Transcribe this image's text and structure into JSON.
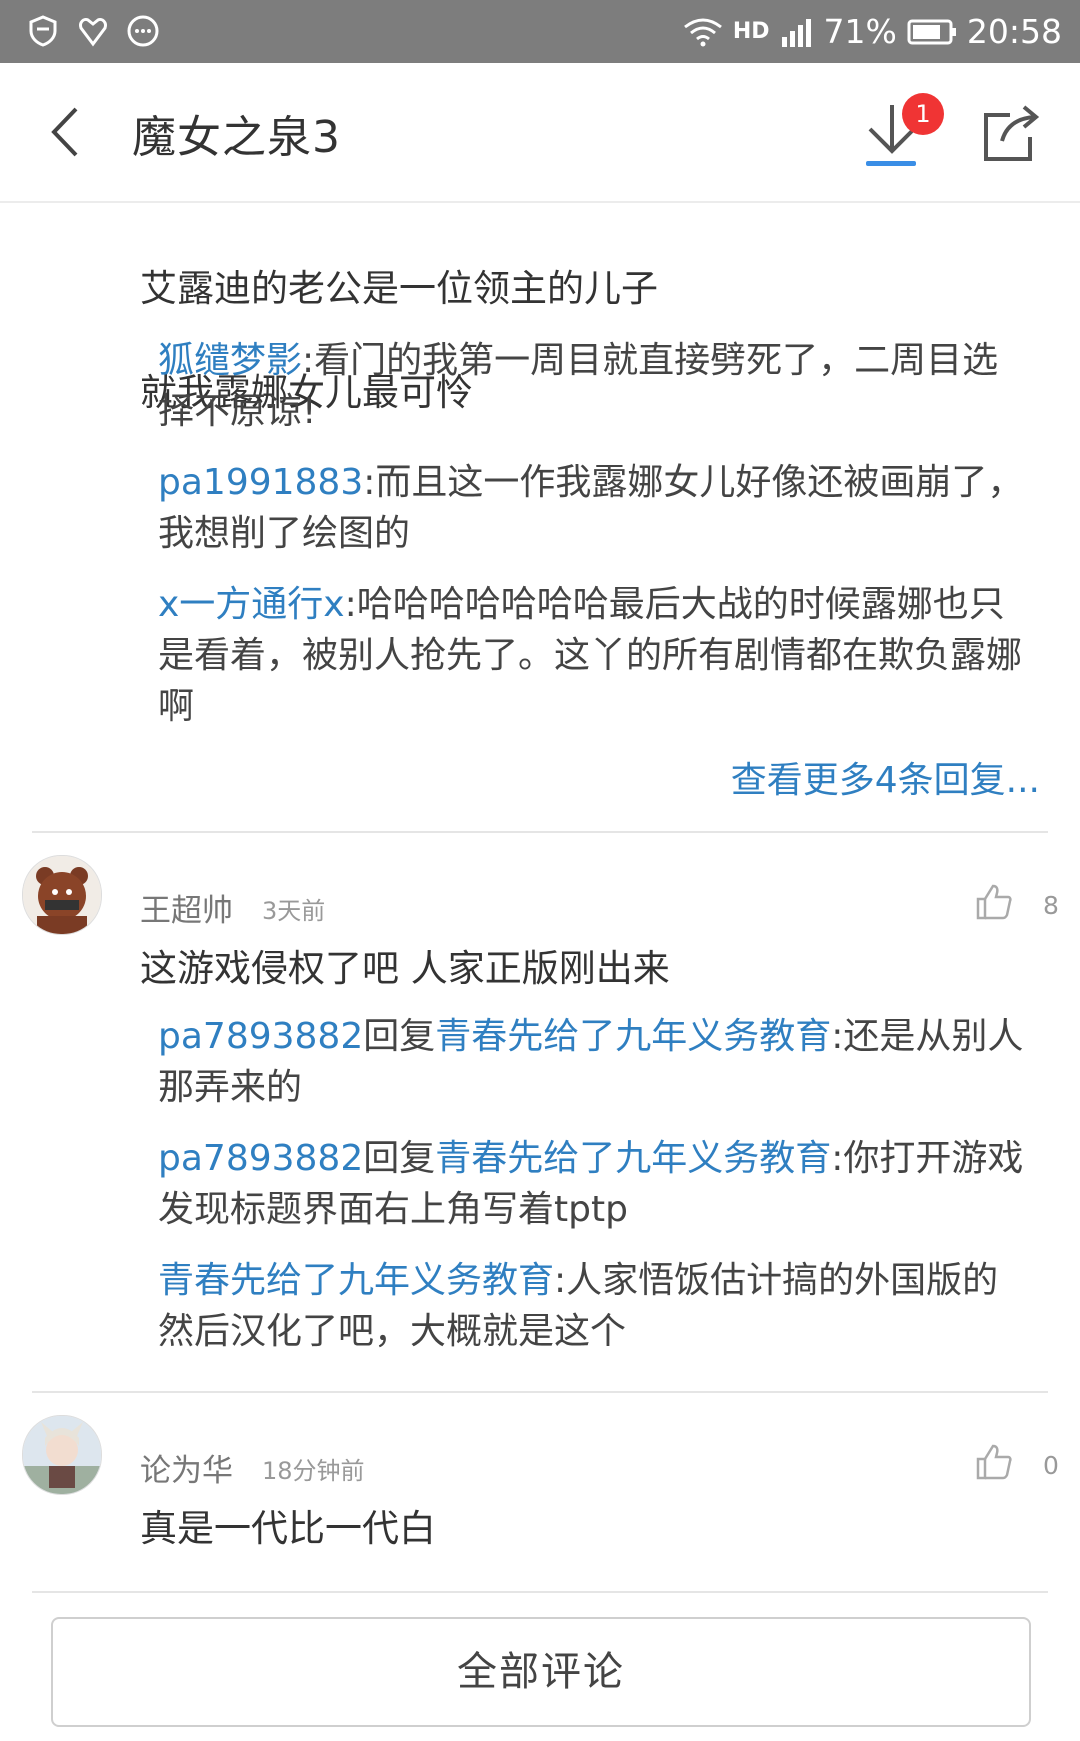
{
  "status_bar": {
    "battery": "71%",
    "time": "20:58",
    "network": "HD"
  },
  "header": {
    "title": "魔女之泉3",
    "download_badge": "1"
  },
  "comment1": {
    "text_lines": [
      "艾露迪的老公是一位领主的儿子",
      "就我露娜女儿最可怜"
    ],
    "replies": [
      {
        "user": "狐缱梦影",
        "text": ":看门的我第一周目就直接劈死了，二周目选择不原谅!"
      },
      {
        "user": "pa1991883",
        "text": ":而且这一作我露娜女儿好像还被画崩了，我想削了绘图的"
      },
      {
        "user": "x一方通行x",
        "text": ":哈哈哈哈哈哈哈最后大战的时候露娜也只是看着，被别人抢先了。这丫的所有剧情都在欺负露娜啊"
      }
    ],
    "more_replies": "查看更多4条回复..."
  },
  "comment2": {
    "author": "王超帅",
    "time": "3天前",
    "likes": "8",
    "text": "这游戏侵权了吧 人家正版刚出来",
    "replies": [
      {
        "user": "pa7893882",
        "reply_word": "回复",
        "target": "青春先给了九年义务教育",
        "text": ":还是从别人那弄来的"
      },
      {
        "user": "pa7893882",
        "reply_word": "回复",
        "target": "青春先给了九年义务教育",
        "text": ":你打开游戏发现标题界面右上角写着tptp"
      },
      {
        "user": "青春先给了九年义务教育",
        "text": ":人家悟饭估计搞的外国版的然后汉化了吧，大概就是这个"
      }
    ]
  },
  "comment3": {
    "author": "论为华",
    "time": "18分钟前",
    "likes": "0",
    "text": "真是一代比一代白"
  },
  "footer": {
    "all_comments": "全部评论"
  }
}
